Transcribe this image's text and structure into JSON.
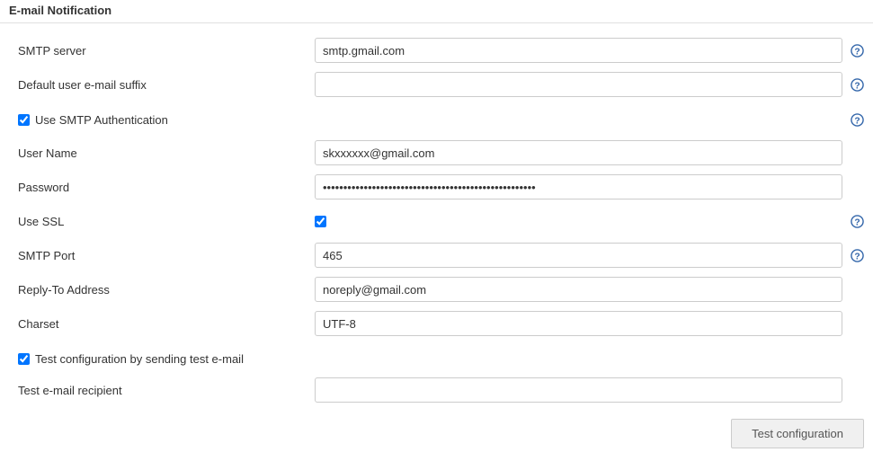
{
  "section": {
    "title": "E-mail Notification"
  },
  "fields": {
    "smtp_server": {
      "label": "SMTP server",
      "value": "smtp.gmail.com"
    },
    "default_suffix": {
      "label": "Default user e-mail suffix",
      "value": ""
    },
    "use_smtp_auth": {
      "label": "Use SMTP Authentication",
      "checked": true
    },
    "user_name": {
      "label": "User Name",
      "value": "skxxxxxx@gmail.com"
    },
    "password": {
      "label": "Password",
      "value": "••••••••••••••••••••••••••••••••••••••••••••••••••••"
    },
    "use_ssl": {
      "label": "Use SSL",
      "checked": true
    },
    "smtp_port": {
      "label": "SMTP Port",
      "value": "465"
    },
    "reply_to": {
      "label": "Reply-To Address",
      "value": "noreply@gmail.com"
    },
    "charset": {
      "label": "Charset",
      "value": "UTF-8"
    },
    "test_config_chk": {
      "label": "Test configuration by sending test e-mail",
      "checked": true
    },
    "test_recipient": {
      "label": "Test e-mail recipient",
      "value": ""
    }
  },
  "buttons": {
    "test_config": "Test configuration"
  }
}
